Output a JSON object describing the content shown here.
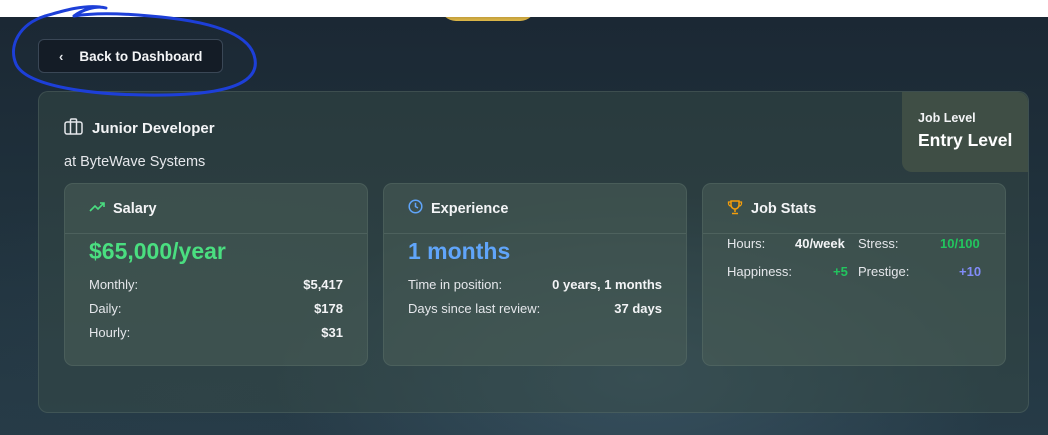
{
  "back_button": {
    "label": "Back to Dashboard"
  },
  "job": {
    "title": "Junior Developer",
    "company": "at ByteWave Systems",
    "level_label": "Job Level",
    "level_value": "Entry Level"
  },
  "salary": {
    "heading": "Salary",
    "annual": "$65,000/year",
    "rows": [
      {
        "label": "Monthly:",
        "value": "$5,417"
      },
      {
        "label": "Daily:",
        "value": "$178"
      },
      {
        "label": "Hourly:",
        "value": "$31"
      }
    ]
  },
  "experience": {
    "heading": "Experience",
    "duration": "1 months",
    "rows": [
      {
        "label": "Time in position:",
        "value": "0 years, 1 months"
      },
      {
        "label": "Days since last review:",
        "value": "37 days"
      }
    ]
  },
  "job_stats": {
    "heading": "Job Stats",
    "hours_label": "Hours:",
    "hours_value": "40/week",
    "stress_label": "Stress:",
    "stress_value": "10/100",
    "happiness_label": "Happiness:",
    "happiness_value": "+5",
    "prestige_label": "Prestige:",
    "prestige_value": "+10"
  },
  "colors": {
    "salary_green": "#4ade80",
    "experience_blue": "#60a5fa",
    "trophy_amber": "#f59e0b",
    "stress_green": "#22c55e",
    "prestige_indigo": "#818cf8",
    "annotation_blue": "#1d3fd8"
  }
}
